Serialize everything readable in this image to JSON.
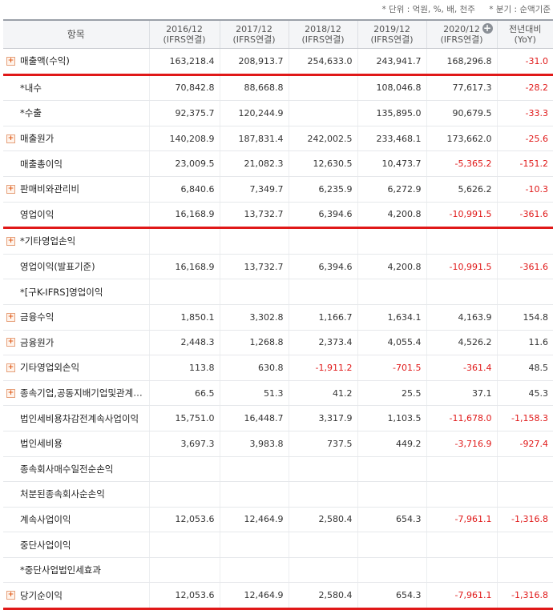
{
  "units": {
    "unit_note": "* 단위 : 억원, %, 배, 천주",
    "basis_note": "* 분기 : 순액기준"
  },
  "header": {
    "item": "항목",
    "periods": [
      {
        "year": "2016/12",
        "type": "(IFRS연결)"
      },
      {
        "year": "2017/12",
        "type": "(IFRS연결)"
      },
      {
        "year": "2018/12",
        "type": "(IFRS연결)"
      },
      {
        "year": "2019/12",
        "type": "(IFRS연결)"
      },
      {
        "year": "2020/12",
        "type": "(IFRS연결)"
      }
    ],
    "yoy_line1": "전년대비",
    "yoy_line2": "(YoY)",
    "plus_icon": "+"
  },
  "rows": [
    {
      "label": "매출액(수익)",
      "expand": true,
      "hl": true,
      "v": [
        "163,218.4",
        "208,913.7",
        "254,633.0",
        "243,941.7",
        "168,296.8",
        "-31.0"
      ]
    },
    {
      "label": "*내수",
      "expand": false,
      "hl": false,
      "v": [
        "70,842.8",
        "88,668.8",
        "",
        "108,046.8",
        "77,617.3",
        "-28.2"
      ]
    },
    {
      "label": "*수출",
      "expand": false,
      "hl": false,
      "v": [
        "92,375.7",
        "120,244.9",
        "",
        "135,895.0",
        "90,679.5",
        "-33.3"
      ]
    },
    {
      "label": "매출원가",
      "expand": true,
      "hl": false,
      "v": [
        "140,208.9",
        "187,831.4",
        "242,002.5",
        "233,468.1",
        "173,662.0",
        "-25.6"
      ]
    },
    {
      "label": "매출총이익",
      "expand": false,
      "hl": false,
      "v": [
        "23,009.5",
        "21,082.3",
        "12,630.5",
        "10,473.7",
        "-5,365.2",
        "-151.2"
      ]
    },
    {
      "label": "판매비와관리비",
      "expand": true,
      "hl": false,
      "v": [
        "6,840.6",
        "7,349.7",
        "6,235.9",
        "6,272.9",
        "5,626.2",
        "-10.3"
      ]
    },
    {
      "label": "영업이익",
      "expand": false,
      "hl": true,
      "v": [
        "16,168.9",
        "13,732.7",
        "6,394.6",
        "4,200.8",
        "-10,991.5",
        "-361.6"
      ]
    },
    {
      "label": "*기타영업손익",
      "expand": true,
      "hl": false,
      "v": [
        "",
        "",
        "",
        "",
        "",
        ""
      ]
    },
    {
      "label": "영업이익(발표기준)",
      "expand": false,
      "hl": false,
      "v": [
        "16,168.9",
        "13,732.7",
        "6,394.6",
        "4,200.8",
        "-10,991.5",
        "-361.6"
      ]
    },
    {
      "label": "*[구K-IFRS]영업이익",
      "expand": false,
      "hl": false,
      "v": [
        "",
        "",
        "",
        "",
        "",
        ""
      ]
    },
    {
      "label": "금융수익",
      "expand": true,
      "hl": false,
      "v": [
        "1,850.1",
        "3,302.8",
        "1,166.7",
        "1,634.1",
        "4,163.9",
        "154.8"
      ]
    },
    {
      "label": "금융원가",
      "expand": true,
      "hl": false,
      "v": [
        "2,448.3",
        "1,268.8",
        "2,373.4",
        "4,055.4",
        "4,526.2",
        "11.6"
      ]
    },
    {
      "label": "기타영업외손익",
      "expand": true,
      "hl": false,
      "v": [
        "113.8",
        "630.8",
        "-1,911.2",
        "-701.5",
        "-361.4",
        "48.5"
      ]
    },
    {
      "label": "종속기업,공동지배기업및관계기업관련손익",
      "expand": true,
      "hl": false,
      "v": [
        "66.5",
        "51.3",
        "41.2",
        "25.5",
        "37.1",
        "45.3"
      ]
    },
    {
      "label": "법인세비용차감전계속사업이익",
      "expand": false,
      "hl": false,
      "v": [
        "15,751.0",
        "16,448.7",
        "3,317.9",
        "1,103.5",
        "-11,678.0",
        "-1,158.3"
      ]
    },
    {
      "label": "법인세비용",
      "expand": false,
      "hl": false,
      "v": [
        "3,697.3",
        "3,983.8",
        "737.5",
        "449.2",
        "-3,716.9",
        "-927.4"
      ]
    },
    {
      "label": "종속회사매수일전순손익",
      "expand": false,
      "hl": false,
      "v": [
        "",
        "",
        "",
        "",
        "",
        ""
      ]
    },
    {
      "label": "처분된종속회사순손익",
      "expand": false,
      "hl": false,
      "v": [
        "",
        "",
        "",
        "",
        "",
        ""
      ]
    },
    {
      "label": "계속사업이익",
      "expand": false,
      "hl": false,
      "v": [
        "12,053.6",
        "12,464.9",
        "2,580.4",
        "654.3",
        "-7,961.1",
        "-1,316.8"
      ]
    },
    {
      "label": "중단사업이익",
      "expand": false,
      "hl": false,
      "v": [
        "",
        "",
        "",
        "",
        "",
        ""
      ]
    },
    {
      "label": "*중단사업법인세효과",
      "expand": false,
      "hl": false,
      "v": [
        "",
        "",
        "",
        "",
        "",
        ""
      ]
    },
    {
      "label": "당기순이익",
      "expand": true,
      "hl": true,
      "v": [
        "12,053.6",
        "12,464.9",
        "2,580.4",
        "654.3",
        "-7,961.1",
        "-1,316.8"
      ]
    }
  ]
}
